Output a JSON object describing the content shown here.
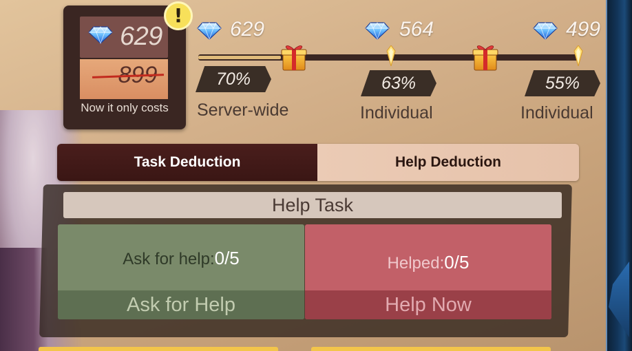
{
  "price": {
    "current": "629",
    "original": "899",
    "note": "Now it only costs"
  },
  "milestones": [
    {
      "price": "629",
      "percent": "70%",
      "label": "Server-wide"
    },
    {
      "price": "564",
      "percent": "63%",
      "label": "Individual"
    },
    {
      "price": "499",
      "percent": "55%",
      "label": "Individual"
    }
  ],
  "tabs": {
    "task": "Task Deduction",
    "help": "Help Deduction",
    "active": "task"
  },
  "help_panel": {
    "title": "Help Task",
    "ask": {
      "label": "Ask for help:",
      "count": "0/5",
      "button": "Ask for Help"
    },
    "helped": {
      "label": "Helped:",
      "count": "0/5",
      "button": "Help Now"
    }
  },
  "icons": {
    "currency": "diamond-icon",
    "reward": "gift-box-icon",
    "alert": "exclamation-icon"
  },
  "colors": {
    "accent": "#e0bb7a",
    "active_tab": "#3a1614",
    "ask_card": "#7a8a6a",
    "help_card": "#c26068"
  }
}
